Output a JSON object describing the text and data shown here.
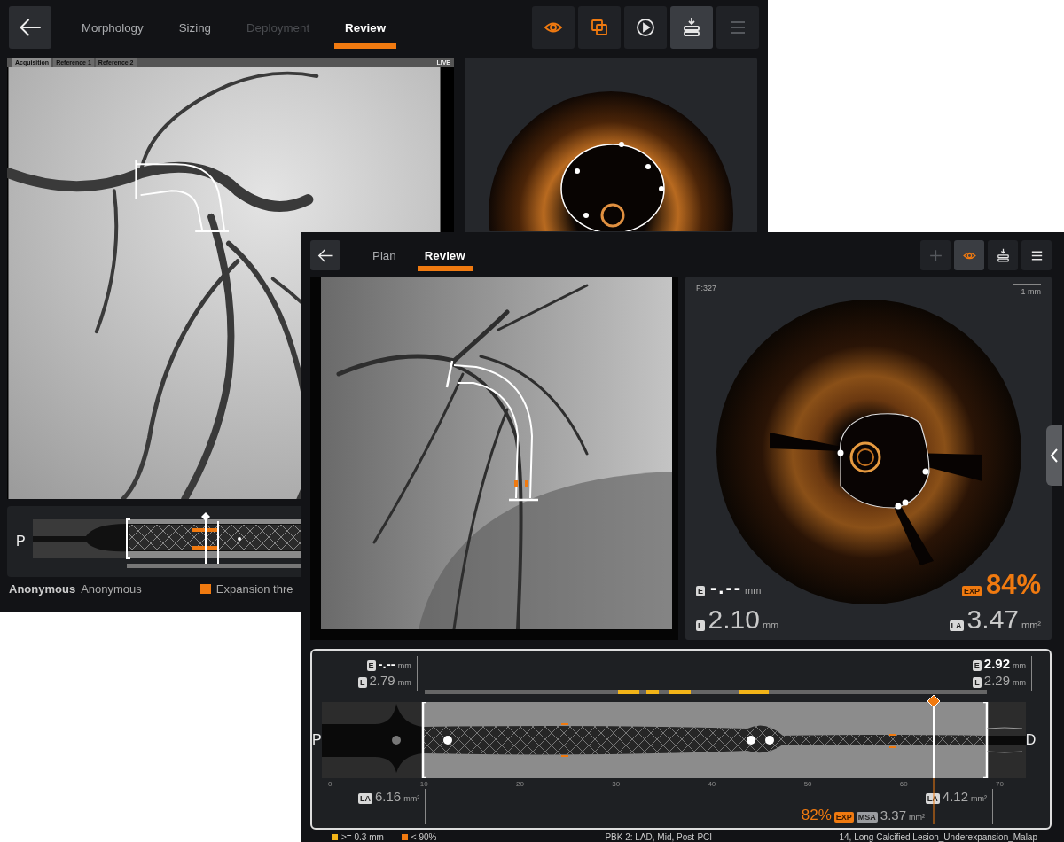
{
  "back_window": {
    "tabs": [
      {
        "label": "Morphology",
        "selected": false,
        "disabled": false
      },
      {
        "label": "Sizing",
        "selected": false,
        "disabled": false
      },
      {
        "label": "Deployment",
        "selected": false,
        "disabled": true
      },
      {
        "label": "Review",
        "selected": true,
        "disabled": false
      }
    ],
    "toolbar": [
      {
        "kind": "eye",
        "active": false,
        "disabled": false
      },
      {
        "kind": "copy",
        "active": false,
        "disabled": false
      },
      {
        "kind": "play",
        "active": false,
        "disabled": false
      },
      {
        "kind": "export",
        "active": true,
        "disabled": false
      },
      {
        "kind": "menu",
        "active": false,
        "disabled": true
      }
    ],
    "angio_tabs": [
      {
        "label": "Acquisition",
        "selected": true
      },
      {
        "label": "Reference 1",
        "selected": false
      },
      {
        "label": "Reference 2",
        "selected": false
      }
    ],
    "live_badge": "LIVE",
    "pullback": {
      "proximal": "P"
    },
    "patient": {
      "name": "Anonymous",
      "id": "Anonymous"
    },
    "legend": "Expansion thre"
  },
  "front_window": {
    "tabs": [
      {
        "label": "Plan",
        "selected": false
      },
      {
        "label": "Review",
        "selected": true
      }
    ],
    "toolbar": [
      {
        "kind": "plus",
        "active": false,
        "disabled": true
      },
      {
        "kind": "eye",
        "active": true,
        "disabled": false
      },
      {
        "kind": "export",
        "active": false,
        "disabled": false
      },
      {
        "kind": "menu",
        "active": false,
        "disabled": false
      }
    ],
    "oct": {
      "frame": "F:327",
      "scale": "1 mm",
      "e": {
        "badge": "E",
        "value": "-.--",
        "unit": "mm"
      },
      "exp": {
        "badge": "EXP",
        "value": "84%"
      },
      "l": {
        "badge": "L",
        "value": "2.10",
        "unit": "mm"
      },
      "la": {
        "badge": "LA",
        "value": "3.47",
        "unit": "mm²"
      }
    },
    "pullback": {
      "left_top": [
        {
          "badge": "E",
          "value": "-.--",
          "unit": "mm"
        },
        {
          "badge": "L",
          "value": "2.79",
          "unit": "mm"
        }
      ],
      "right_top": [
        {
          "badge": "E",
          "value": "2.92",
          "unit": "mm"
        },
        {
          "badge": "L",
          "value": "2.29",
          "unit": "mm"
        }
      ],
      "proximal": "P",
      "distal": "D",
      "axis_ticks": [
        "0",
        "10",
        "20",
        "30",
        "40",
        "50",
        "60",
        "70"
      ],
      "marker": {
        "level": 0.87
      },
      "left_area": {
        "badge": "LA",
        "value": "6.16",
        "unit": "mm²"
      },
      "right_area": {
        "badge": "LA",
        "value": "4.12",
        "unit": "mm²"
      },
      "msa": {
        "percent": "82%",
        "exp_badge": "EXP",
        "msa_badge": "MSA",
        "value": "3.37",
        "unit": "mm²"
      }
    },
    "footer": {
      "legend": [
        {
          "label": ">= 0.3 mm",
          "color": "#f2b418"
        },
        {
          "label": "< 90%",
          "color": "#f07a10"
        }
      ],
      "pullback_info": "PBK 2: LAD, Mid, Post-PCI",
      "lesion": "14, Long Calcified Lesion_Underexpansion_Malap"
    }
  }
}
